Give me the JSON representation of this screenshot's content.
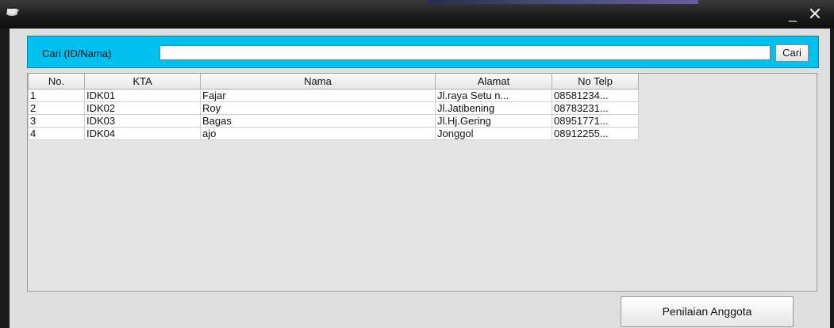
{
  "window": {
    "icon": "java-cup-icon",
    "minimize_label": "_",
    "close_label": "✕"
  },
  "search": {
    "label": "Cari (ID/Nama)",
    "value": "",
    "button_label": "Cari",
    "panel_color": "#00c0f0"
  },
  "table": {
    "columns": [
      "No.",
      "KTA",
      "Nama",
      "Alamat",
      "No Telp"
    ],
    "rows": [
      [
        "1",
        "IDK01",
        "Fajar",
        "Jl.raya Setu n...",
        "08581234..."
      ],
      [
        "2",
        "IDK02",
        "Roy",
        "Jl.Jatibening",
        "08783231..."
      ],
      [
        "3",
        "IDK03",
        "Bagas",
        "Jl.Hj.Gering",
        "08951771..."
      ],
      [
        "4",
        "IDK04",
        "ajo",
        "Jonggol",
        "08912255..."
      ]
    ]
  },
  "footer": {
    "button_label": "Penilaian Anggota"
  }
}
